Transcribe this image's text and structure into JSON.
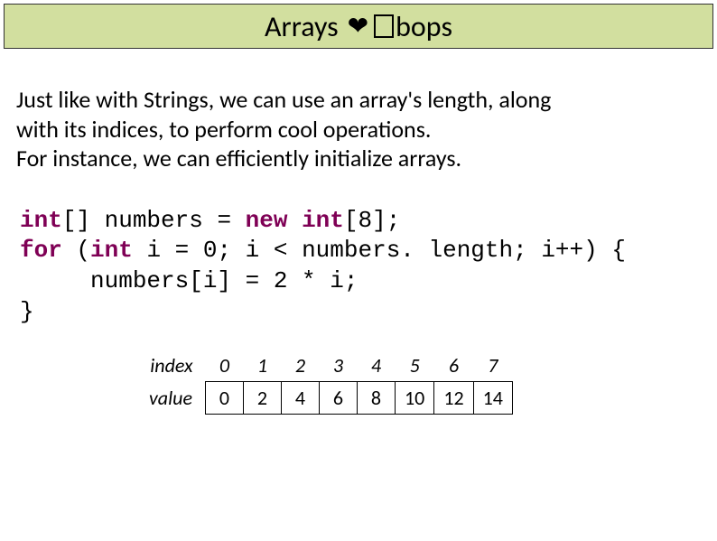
{
  "title": {
    "word1": "Arrays",
    "word2_suffix": "bops"
  },
  "paragraph": {
    "line1": "Just like with Strings, we can use an array's length, along",
    "line2": "with its indices, to perform cool operations.",
    "line3": "For instance, we can efficiently initialize arrays."
  },
  "code": {
    "l1_a": "int",
    "l1_b": "[] numbers = ",
    "l1_c": "new",
    "l1_d": " int",
    "l1_e": "[8];",
    "l2_a": "for",
    "l2_b": " (",
    "l2_c": "int",
    "l2_d": " i = 0; i < numbers. length; i++) {",
    "l3": "     numbers[i] = 2 * i;",
    "l4": "}"
  },
  "table": {
    "index_label": "index",
    "value_label": "value",
    "indices": [
      "0",
      "1",
      "2",
      "3",
      "4",
      "5",
      "6",
      "7"
    ],
    "values": [
      "0",
      "2",
      "4",
      "6",
      "8",
      "10",
      "12",
      "14"
    ]
  }
}
